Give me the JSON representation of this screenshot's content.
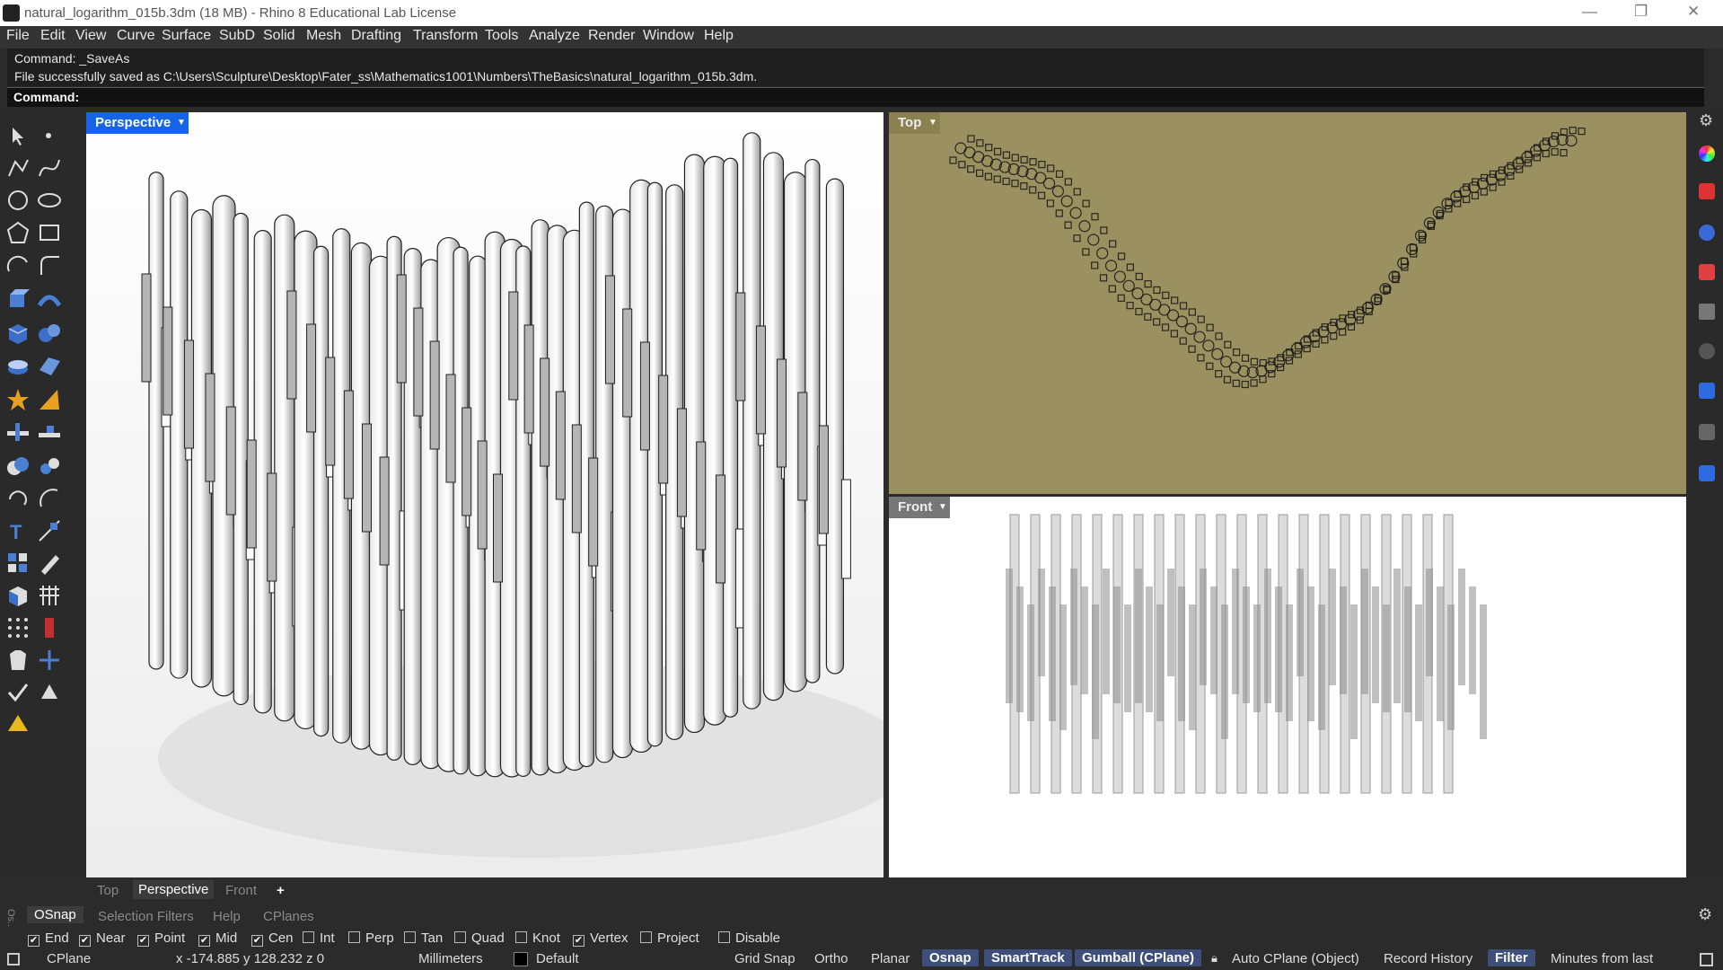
{
  "window": {
    "title": "natural_logarithm_015b.3dm (18 MB) - Rhino 8 Educational Lab License",
    "minimize_glyph": "—",
    "restore_glyph": "❐",
    "close_glyph": "✕"
  },
  "menu": [
    "File",
    "Edit",
    "View",
    "Curve",
    "Surface",
    "SubD",
    "Solid",
    "Mesh",
    "Drafting",
    "Transform",
    "Tools",
    "Analyze",
    "Render",
    "Window",
    "Help"
  ],
  "command": {
    "history": [
      "Command: _SaveAs",
      "File successfully saved as C:\\Users\\Sculpture\\Desktop\\Fater_ss\\Mathematics1001\\Numbers\\TheBasics\\natural_logarithm_015b.3dm."
    ],
    "prompt_label": "Command:",
    "input_value": ""
  },
  "viewports": {
    "perspective": {
      "label": "Perspective",
      "active": true
    },
    "top": {
      "label": "Top"
    },
    "front": {
      "label": "Front"
    }
  },
  "viewport_tabs": {
    "items": [
      "Top",
      "Perspective",
      "Front"
    ],
    "active": "Perspective",
    "add_label": "+"
  },
  "panel_tabs": {
    "items": [
      "OSnap",
      "Selection Filters",
      "Help",
      "CPlanes"
    ],
    "active": "OSnap",
    "side_label": "Os..."
  },
  "osnaps": [
    {
      "label": "End",
      "checked": true
    },
    {
      "label": "Near",
      "checked": true
    },
    {
      "label": "Point",
      "checked": true
    },
    {
      "label": "Mid",
      "checked": true
    },
    {
      "label": "Cen",
      "checked": true
    },
    {
      "label": "Int",
      "checked": false
    },
    {
      "label": "Perp",
      "checked": false
    },
    {
      "label": "Tan",
      "checked": false
    },
    {
      "label": "Quad",
      "checked": false
    },
    {
      "label": "Knot",
      "checked": false
    },
    {
      "label": "Vertex",
      "checked": true
    },
    {
      "label": "Project",
      "checked": false
    },
    {
      "label": "Disable",
      "checked": false
    }
  ],
  "status": {
    "cplane": "CPlane",
    "coords": "x -174.885  y 128.232  z 0",
    "units": "Millimeters",
    "layer": "Default",
    "grid_snap": "Grid Snap",
    "ortho": "Ortho",
    "planar": "Planar",
    "osnap": "Osnap",
    "smarttrack": "SmartTrack",
    "gumball": "Gumball (CPlane)",
    "auto_cplane": "Auto CPlane (Object)",
    "record_history": "Record History",
    "filter": "Filter",
    "minutes": "Minutes from last"
  },
  "colors": {
    "accent": "#1565e6",
    "pill": "#3d4f7a",
    "top_bg": "#9a9060"
  },
  "icons": [
    "rhino-logo-icon",
    "select-arrow-icon",
    "point-icon",
    "polyline-icon",
    "curve-icon",
    "circle-icon",
    "ellipse-icon",
    "polygon-icon",
    "rectangle-icon",
    "arc-icon",
    "fillet-icon",
    "extrude-icon",
    "box-icon",
    "sphere-icon",
    "boolean-icon",
    "gumball-icon",
    "text-icon",
    "array-icon",
    "dimension-icon",
    "settings-gear-icon"
  ]
}
